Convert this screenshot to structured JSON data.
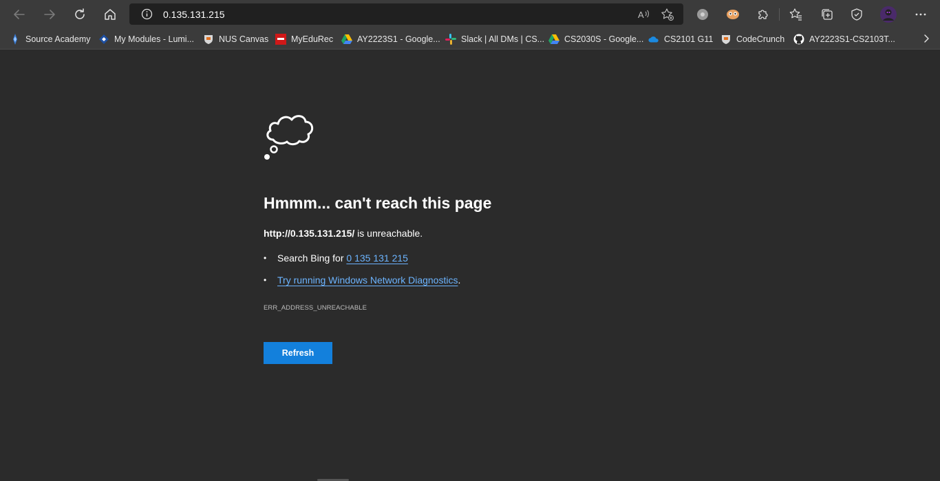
{
  "toolbar": {
    "url": "0.135.131.215"
  },
  "bookmarks": [
    {
      "label": "Source Academy",
      "icon": "source-academy-icon"
    },
    {
      "label": "My Modules - Lumi...",
      "icon": "lumiere-icon"
    },
    {
      "label": "NUS Canvas",
      "icon": "nus-icon"
    },
    {
      "label": "MyEduRec",
      "icon": "myedurec-icon"
    },
    {
      "label": "AY2223S1 - Google...",
      "icon": "google-drive-icon"
    },
    {
      "label": "Slack | All DMs | CS...",
      "icon": "slack-icon"
    },
    {
      "label": "CS2030S - Google...",
      "icon": "google-drive-icon"
    },
    {
      "label": "CS2101 G11",
      "icon": "onedrive-icon"
    },
    {
      "label": "CodeCrunch",
      "icon": "nus-icon"
    },
    {
      "label": "AY2223S1-CS2103T...",
      "icon": "github-icon"
    }
  ],
  "error_page": {
    "title": "Hmmm... can't reach this page",
    "url_text": "http://0.135.131.215/",
    "unreachable_text": " is unreachable.",
    "search_prefix": "Search Bing for ",
    "search_link": "0 135 131 215",
    "diagnostics_link": "Try running Windows Network Diagnostics",
    "diagnostics_suffix": ".",
    "error_code": "ERR_ADDRESS_UNREACHABLE",
    "refresh_label": "Refresh"
  },
  "colors": {
    "background": "#2b2b2b",
    "toolbar": "#3b3b3b",
    "link": "#6cb4ff",
    "button": "#1380dc"
  }
}
